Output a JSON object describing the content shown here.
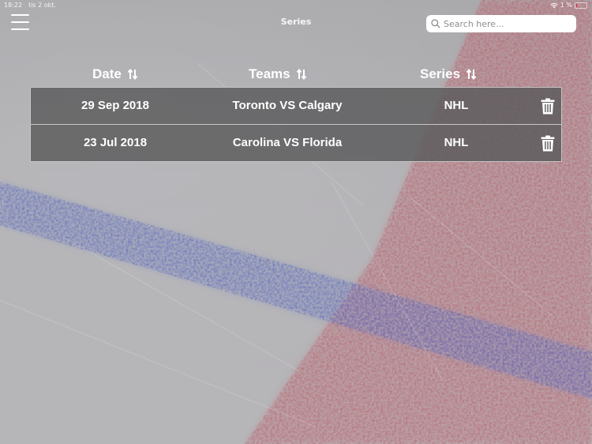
{
  "status_bar": {
    "time": "18:22",
    "date": "tis 2 okt.",
    "battery_percent": "1 %",
    "wifi_icon": "wifi-icon",
    "battery_icon": "battery-icon"
  },
  "nav": {
    "menu_icon": "hamburger-menu-icon",
    "title": "Series",
    "search": {
      "placeholder": "Search here...",
      "value": "",
      "icon": "search-icon"
    }
  },
  "table": {
    "columns": [
      {
        "label": "Date",
        "sort_icon": "sort-arrows-icon"
      },
      {
        "label": "Teams",
        "sort_icon": "sort-arrows-icon"
      },
      {
        "label": "Series",
        "sort_icon": "sort-arrows-icon"
      }
    ],
    "rows": [
      {
        "date": "29 Sep 2018",
        "teams": "Toronto VS Calgary",
        "series": "NHL",
        "action_icon": "trash-icon"
      },
      {
        "date": "23 Jul 2018",
        "teams": "Carolina VS Florida",
        "series": "NHL",
        "action_icon": "trash-icon"
      }
    ]
  },
  "colors": {
    "row_background": "#5a5a5c",
    "text": "#ffffff",
    "blue_line": "#4a5fbf",
    "red_line": "#c2505e"
  }
}
